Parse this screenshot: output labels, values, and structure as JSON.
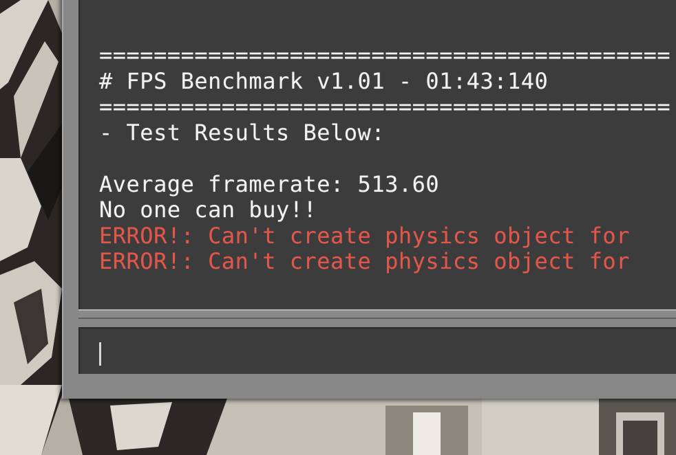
{
  "console": {
    "lines": [
      {
        "text": "==========================================",
        "type": "separator"
      },
      {
        "text": "# FPS Benchmark v1.01 - 01:43:140",
        "type": "header"
      },
      {
        "text": "==========================================",
        "type": "separator"
      },
      {
        "text": "- Test Results Below:",
        "type": "normal"
      },
      {
        "text": "",
        "type": "blank"
      },
      {
        "text": "Average framerate: 513.60",
        "type": "normal"
      },
      {
        "text": "No one can buy!!",
        "type": "normal"
      },
      {
        "text": "ERROR!: Can't create physics object for",
        "type": "error"
      },
      {
        "text": "ERROR!: Can't create physics object for",
        "type": "error"
      }
    ],
    "input_value": ""
  },
  "colors": {
    "text": "#f2f2f2",
    "error": "#e2574b",
    "panel_bg": "#3c3c3c",
    "frame": "#878787"
  }
}
